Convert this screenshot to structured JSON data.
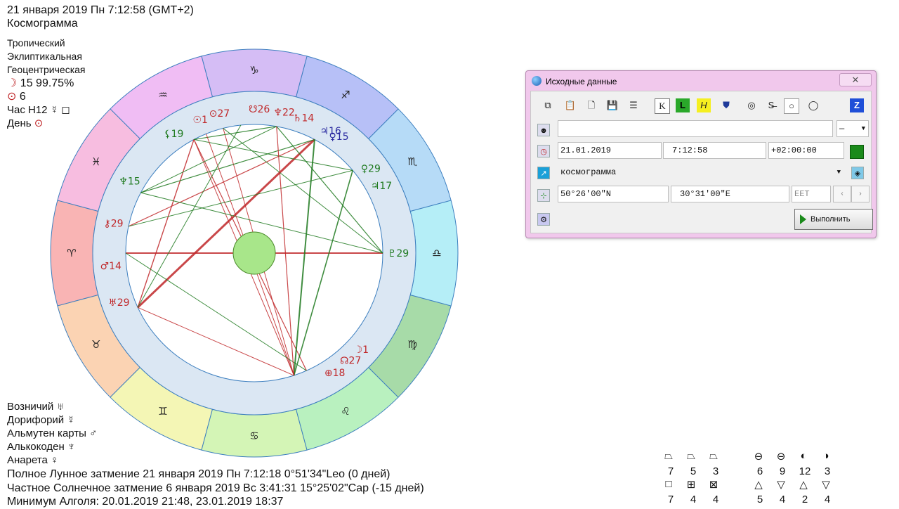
{
  "header": {
    "datetime": "21 января 2019  Пн   7:12:58 (GMT+2)",
    "chart_kind": "Космограмма"
  },
  "settings": {
    "zodiac": "Тропический",
    "coords": "Эклиптикальная",
    "center": "Геоцентрическая",
    "moon_phase": "15 99.75%",
    "sun_value": "6",
    "hour": "Час H12",
    "day": "День"
  },
  "signs": [
    "♈",
    "♉",
    "♊",
    "♋",
    "♌",
    "♍",
    "♎",
    "♏",
    "♐",
    "♑",
    "♒",
    "♓"
  ],
  "planets": [
    {
      "glyph": "♄",
      "val": "14",
      "color": "#c0282a"
    },
    {
      "glyph": "♆",
      "val": "22",
      "color": "#c0282a"
    },
    {
      "glyph": "☋",
      "val": "26",
      "color": "#c0282a"
    },
    {
      "glyph": "⊙",
      "val": "27",
      "color": "#c0282a"
    },
    {
      "glyph": "☉",
      "val": "1",
      "color": "#c0282a"
    },
    {
      "glyph": "⚸",
      "val": "19",
      "color": "#1f7a1f"
    },
    {
      "glyph": "♆",
      "val": "15",
      "color": "#1f7a1f"
    },
    {
      "glyph": "⚷",
      "val": "29",
      "color": "#c0282a"
    },
    {
      "glyph": "♂",
      "val": "14",
      "color": "#c0282a"
    },
    {
      "glyph": "♅",
      "val": "29",
      "color": "#c0282a"
    },
    {
      "glyph": "♃",
      "val": "16",
      "color": "#2a2aa0"
    },
    {
      "glyph": "♀",
      "val": "15",
      "color": "#2a2aa0"
    },
    {
      "glyph": "♀",
      "val": "29",
      "color": "#1f7a1f"
    },
    {
      "glyph": "♃",
      "val": "17",
      "color": "#1f7a1f"
    },
    {
      "glyph": "♇",
      "val": "29",
      "color": "#1f7a1f"
    },
    {
      "glyph": "☽",
      "val": "1",
      "color": "#c0282a"
    },
    {
      "glyph": "☊",
      "val": "27",
      "color": "#c0282a"
    },
    {
      "glyph": "⊕",
      "val": "18",
      "color": "#c0282a"
    }
  ],
  "rulers": {
    "vozn": "Возничий",
    "dorif": "Дорифорий",
    "almuten": "Альмутен карты",
    "alkokoden": "Алькокоден",
    "anareta": "Анарета"
  },
  "events": [
    "Полное Лунное затмение 21 января 2019 Пн  7:12:18  0°51'34\"Leo (0 дней)",
    "Частное Солнечное затмение 6 января 2019 Вс  3:41:31 15°25'02\"Cap (-15 дней)",
    "Минимум Алголя: 20.01.2019 21:48,  23.01.2019 18:37"
  ],
  "aspect_counts": {
    "row1": [
      "7",
      "5",
      "3",
      "6",
      "9",
      "12",
      "3"
    ],
    "row2": [
      "7",
      "4",
      "4",
      "5",
      "4",
      "2",
      "4"
    ]
  },
  "dialog": {
    "title": "Исходные данные",
    "close": "✕",
    "name_value": "",
    "gender_value": "—",
    "date": "21.01.2019",
    "time": "7:12:58",
    "tz": "+02:00:00",
    "chart_type": "космограмма",
    "lat": "50°26'00\"N",
    "lon": "30°31'00\"E",
    "zone_placeholder": "EET",
    "run": "Выполнить",
    "toolbar_letters": {
      "k": "K",
      "l": "L",
      "h": "H",
      "z": "Z"
    }
  },
  "colors": {
    "ring_fire": "#fbb6b6",
    "ring_bg": "#dbe7f3",
    "center": "#a8e68a",
    "aspect_red": "#c0282a",
    "aspect_green": "#1f7a1f"
  }
}
